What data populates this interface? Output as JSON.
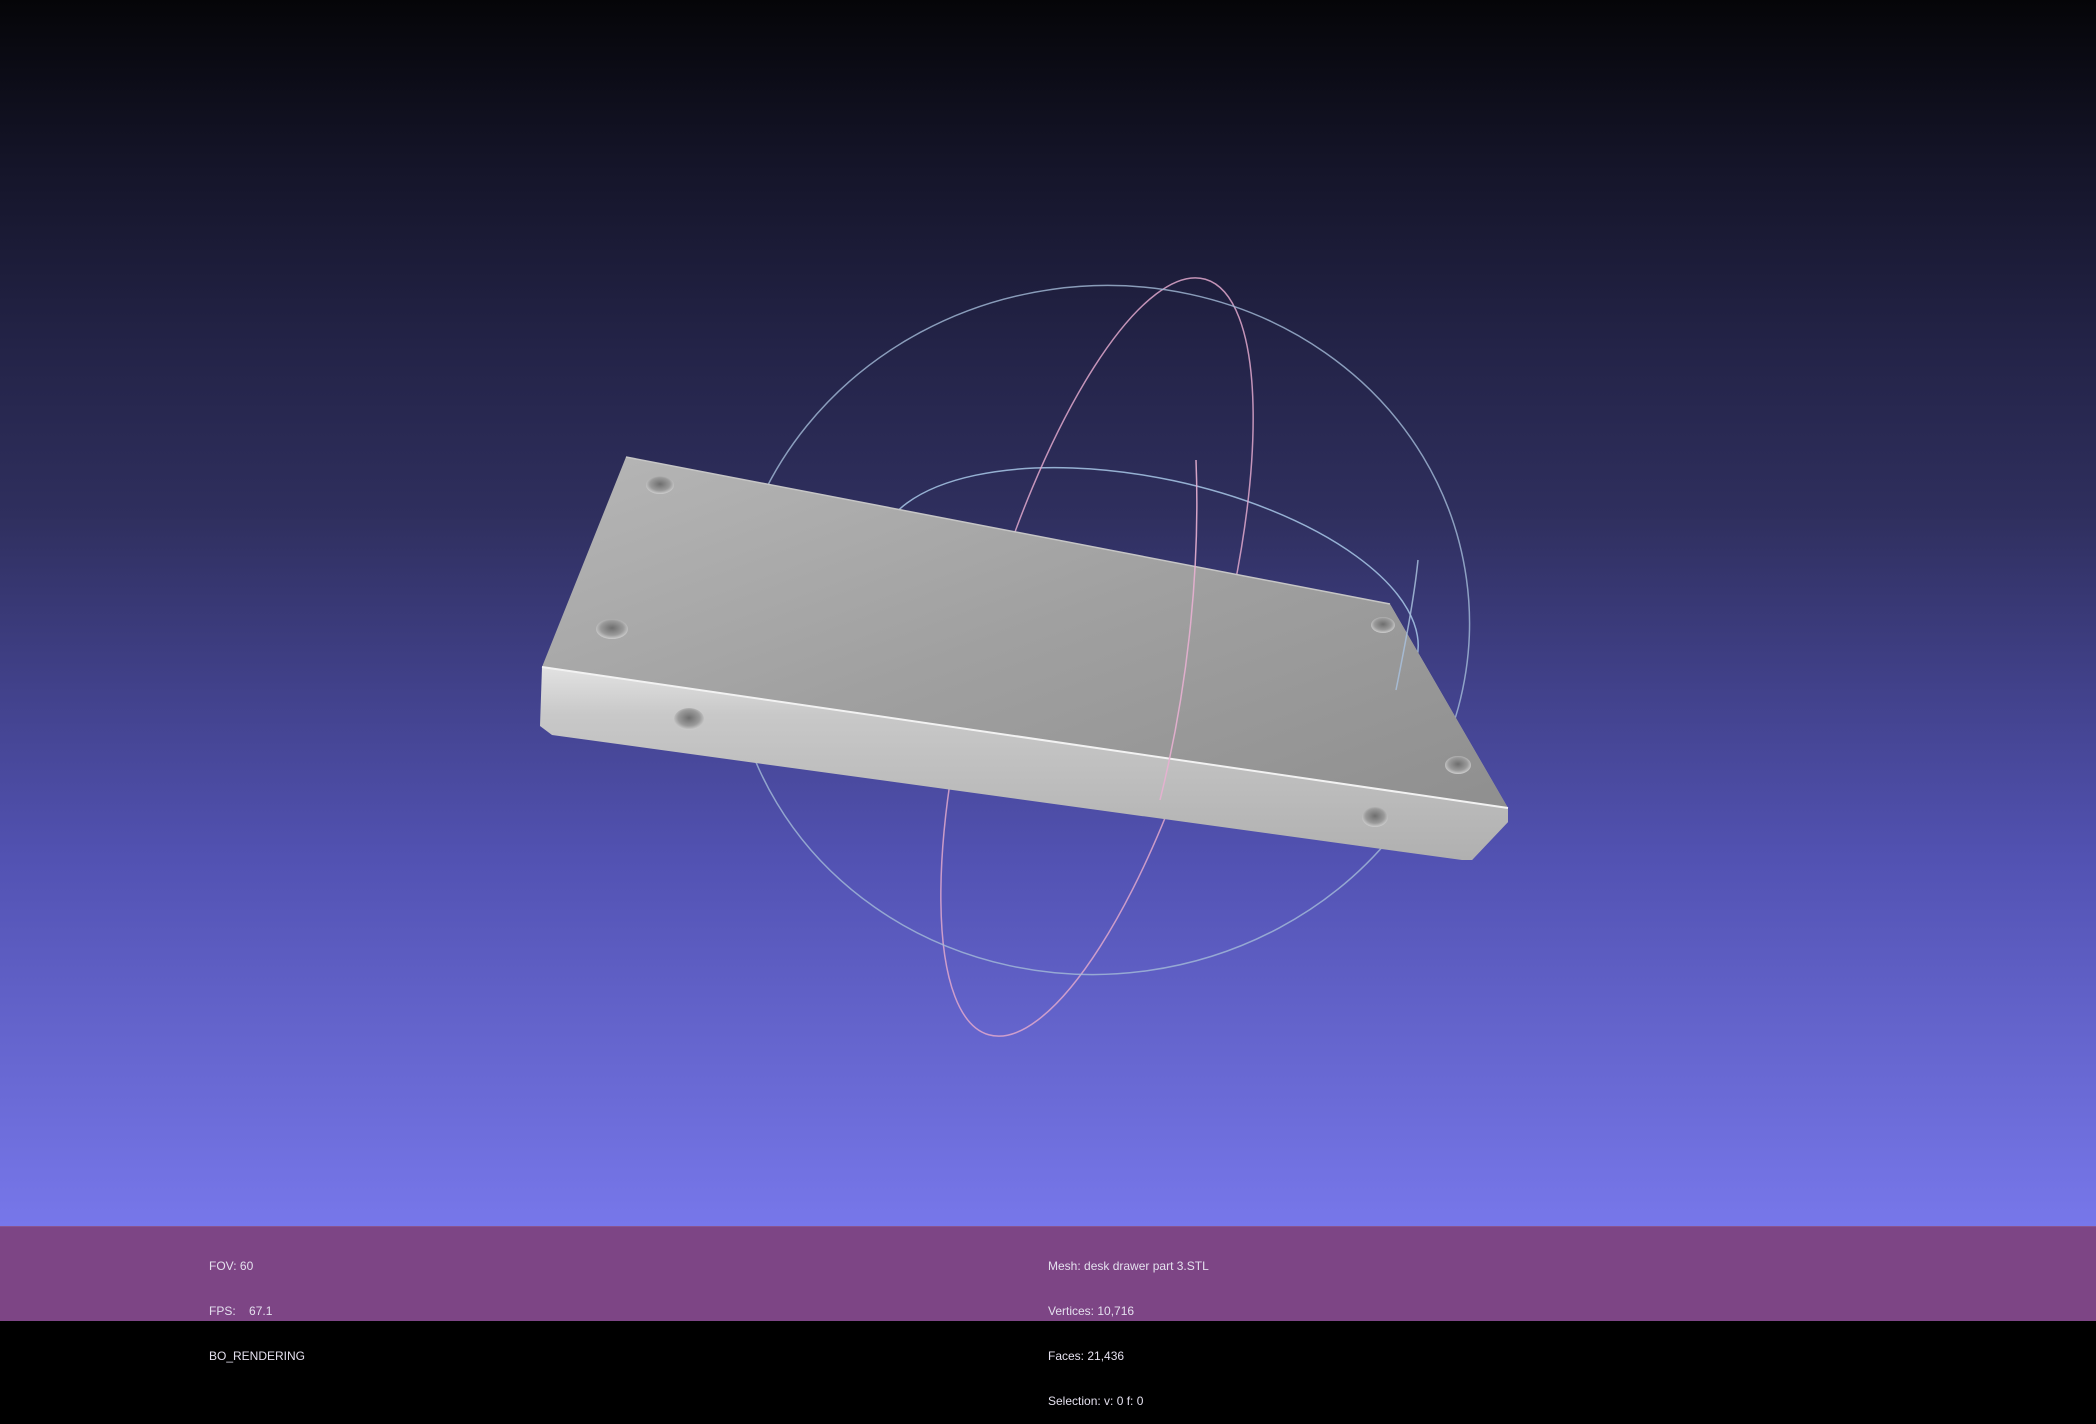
{
  "viewport": {
    "background_top": "#050508",
    "background_bottom": "#7777ea",
    "mesh_color": "#b4b4b4",
    "trackball_colors": [
      "#a8c8e8",
      "#e0a0c8",
      "#9fb8d8"
    ]
  },
  "left_info": {
    "fov_label": "FOV:",
    "fov_value": "60",
    "fps_label": "FPS:",
    "fps_value": "67.1",
    "render_mode": "BO_RENDERING"
  },
  "right_info": {
    "mesh_label": "Mesh:",
    "mesh_name": "desk drawer part 3.STL",
    "vertices_label": "Vertices:",
    "vertices_value": "10,716",
    "faces_label": "Faces:",
    "faces_value": "21,436",
    "selection_label": "Selection:",
    "selection_value": "v: 0 f: 0"
  },
  "infobar_color": "#7d4585"
}
